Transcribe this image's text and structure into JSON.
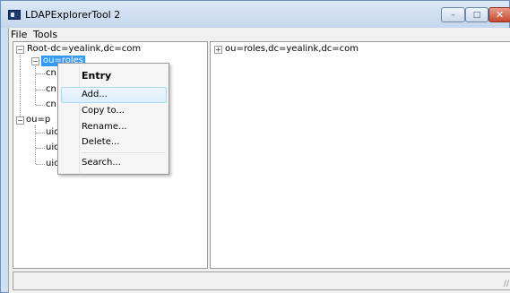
{
  "window": {
    "title": "LDAPExplorerTool 2",
    "min_glyph": "–",
    "max_glyph": "□",
    "close_glyph": "✕"
  },
  "menubar": {
    "file": "File",
    "tools": "Tools"
  },
  "tree": {
    "root": "Root-dc=yealink,dc=com",
    "roles": "ou=roles",
    "role_children": [
      "cn",
      "cn",
      "cn"
    ],
    "people": "ou=p",
    "people_children": [
      "uic",
      "uic",
      "uic"
    ],
    "toggle_expanded": "−"
  },
  "detail": {
    "node": "ou=roles,dc=yealink,dc=com",
    "toggle": "+"
  },
  "context_menu": {
    "entry": "Entry",
    "add": "Add...",
    "copy": "Copy to...",
    "rename": "Rename...",
    "delete": "Delete...",
    "search": "Search..."
  },
  "statusbar": {
    "grip": "//"
  },
  "icons": {
    "app": "app-window-icon",
    "minimize": "minimize-icon",
    "maximize": "maximize-icon",
    "close": "close-icon"
  },
  "colors": {
    "selection": "#3399ff",
    "close_button": "#c74a2f",
    "titlebar": "#c4d7ec"
  }
}
